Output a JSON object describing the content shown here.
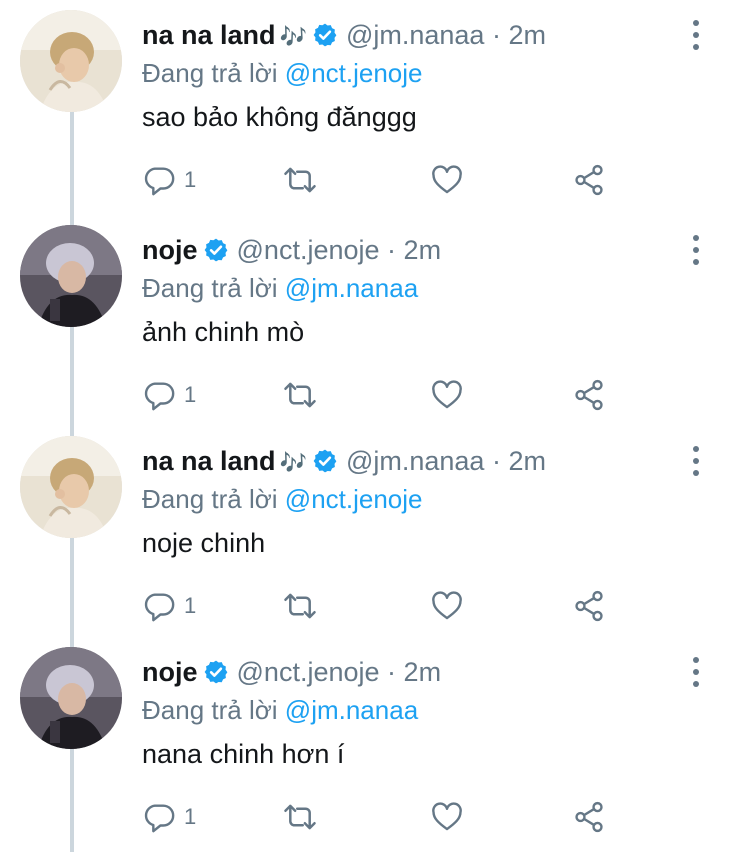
{
  "tweets": [
    {
      "name": "na na land",
      "music": "🎶",
      "handle": "@jm.nanaa",
      "separator": "·",
      "time": "2m",
      "reply_prefix": "Đang trả lời",
      "reply_to": "@nct.jenoje",
      "text": "sao bảo không đănggg",
      "reply_count": "1",
      "avatar_icon": "avatar-photo-blonde"
    },
    {
      "name": "noje",
      "music": "",
      "handle": "@nct.jenoje",
      "separator": "·",
      "time": "2m",
      "reply_prefix": "Đang trả lời",
      "reply_to": "@jm.nanaa",
      "text": "ảnh chinh mò",
      "reply_count": "1",
      "avatar_icon": "avatar-photo-silver-hair"
    },
    {
      "name": "na na land",
      "music": "🎶",
      "handle": "@jm.nanaa",
      "separator": "·",
      "time": "2m",
      "reply_prefix": "Đang trả lời",
      "reply_to": "@nct.jenoje",
      "text": "noje chinh",
      "reply_count": "1",
      "avatar_icon": "avatar-photo-blonde"
    },
    {
      "name": "noje",
      "music": "",
      "handle": "@nct.jenoje",
      "separator": "·",
      "time": "2m",
      "reply_prefix": "Đang trả lời",
      "reply_to": "@jm.nanaa",
      "text": "nana chinh hơn í",
      "reply_count": "1",
      "avatar_icon": "avatar-photo-silver-hair"
    }
  ],
  "icons": {
    "reply": "reply-icon",
    "retweet": "retweet-icon",
    "like": "heart-icon",
    "share": "share-icon",
    "more": "more-vertical-icon",
    "verified": "verified-badge-icon"
  },
  "colors": {
    "accent": "#1da1f2",
    "muted": "#657786",
    "text": "#14171a",
    "thread_line": "#ccd6dd"
  }
}
